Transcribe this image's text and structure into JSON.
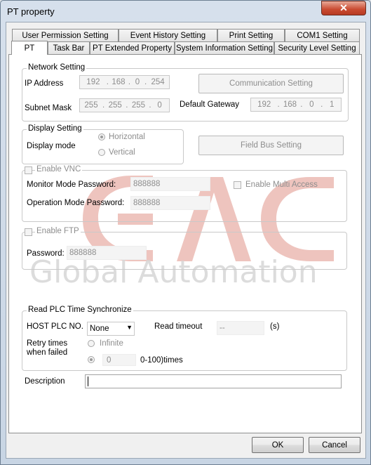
{
  "window": {
    "title": "PT property",
    "close_glyph": "✕"
  },
  "tabs_row1": [
    "User Permission Setting",
    "Event History Setting",
    "Print Setting",
    "COM1 Setting"
  ],
  "tabs_row2": [
    "PT",
    "Task Bar",
    "PT Extended Property",
    "System Information Setting",
    "Security Level Setting"
  ],
  "network": {
    "legend": "Network Setting",
    "ip_label": "IP Address",
    "ip": [
      "192",
      "168",
      "0",
      "254"
    ],
    "mask_label": "Subnet Mask",
    "mask": [
      "255",
      "255",
      "255",
      "0"
    ],
    "gateway_label": "Default Gateway",
    "gateway": [
      "192",
      "168",
      "0",
      "1"
    ],
    "comm_button": "Communication Setting"
  },
  "display": {
    "legend": "Display Setting",
    "mode_label": "Display mode",
    "horizontal": "Horizontal",
    "vertical": "Vertical",
    "fieldbus_button": "Field Bus Setting"
  },
  "vnc": {
    "enable_label": "Enable VNC",
    "monitor_label": "Monitor Mode Password:",
    "monitor_value": "888888",
    "operation_label": "Operation Mode Password:",
    "operation_value": "888888",
    "multi_label": "Enable Multi Access"
  },
  "ftp": {
    "enable_label": "Enable FTP",
    "password_label": "Password:",
    "password_value": "888888"
  },
  "watermark": {
    "logo": "GAC",
    "text": "Global Automation"
  },
  "plc": {
    "legend": "Read PLC Time Synchronize",
    "host_label": "HOST PLC NO.",
    "host_value": "None",
    "timeout_label": "Read timeout",
    "timeout_value": "--",
    "timeout_unit": "(s)",
    "retry_label_1": "Retry times",
    "retry_label_2": "when failed",
    "infinite_label": "Infinite",
    "retry_value": "0",
    "retry_range": "0-100)times"
  },
  "description_label": "Description",
  "description_value": "",
  "ok_button": "OK",
  "cancel_button": "Cancel",
  "colors": {
    "watermark_red": "#e8a7a0",
    "watermark_gray": "#d9d9d9",
    "close_red": "#c94b31"
  }
}
